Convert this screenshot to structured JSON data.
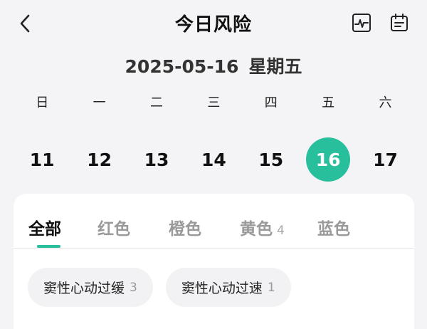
{
  "header": {
    "title": "今日风险",
    "back_icon": "chevron-left-icon",
    "actions": [
      {
        "icon": "heartbeat-chart-icon"
      },
      {
        "icon": "calendar-icon"
      }
    ]
  },
  "date": {
    "date_text": "2025-05-16",
    "weekday_text": "星期五"
  },
  "week": {
    "days": [
      "日",
      "一",
      "二",
      "三",
      "四",
      "五",
      "六"
    ]
  },
  "calendar": {
    "dates": [
      "11",
      "12",
      "13",
      "14",
      "15",
      "16",
      "17"
    ],
    "selected": "16",
    "selected_color": "#27bf9c"
  },
  "tabs": {
    "items": [
      {
        "label": "全部",
        "count": ""
      },
      {
        "label": "红色",
        "count": ""
      },
      {
        "label": "橙色",
        "count": ""
      },
      {
        "label": "黄色",
        "count": "4"
      },
      {
        "label": "蓝色",
        "count": ""
      }
    ],
    "active": "全部"
  },
  "risks": {
    "items": [
      {
        "label": "窦性心动过缓",
        "count": "3"
      },
      {
        "label": "窦性心动过速",
        "count": "1"
      }
    ]
  }
}
